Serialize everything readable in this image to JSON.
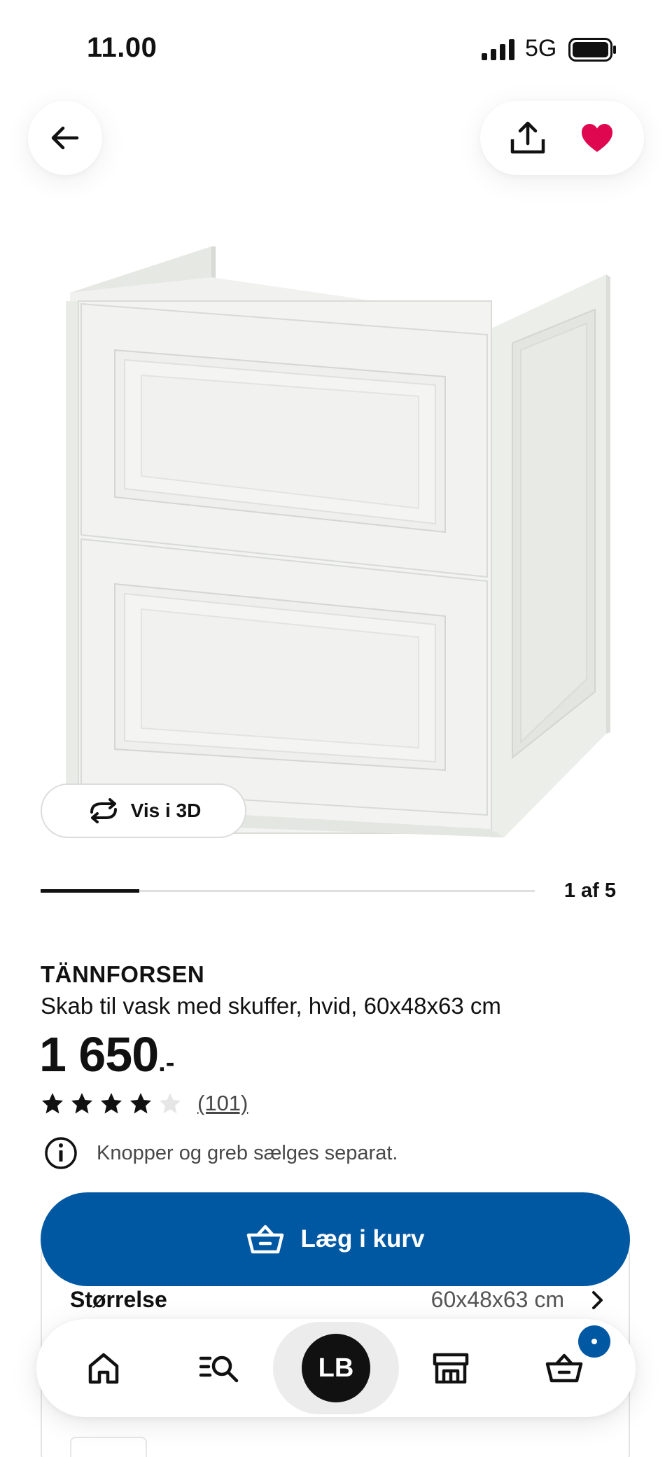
{
  "status_bar": {
    "time": "11.00",
    "network": "5G",
    "signal_icon": "cellular-signal-icon",
    "battery_icon": "battery-icon"
  },
  "header": {
    "back_icon": "arrow-left-icon",
    "share_icon": "share-upload-icon",
    "favorite_icon": "heart-filled-icon",
    "favorite_color": "#e00751"
  },
  "gallery": {
    "view_3d_label": "Vis i 3D",
    "view_3d_icon": "rotate-3d-icon",
    "position_label": "1 af 5",
    "progress_fraction": 0.2
  },
  "product": {
    "name": "TÄNNFORSEN",
    "description": "Skab til vask med skuffer, hvid, 60x48x63 cm",
    "price": "1 650",
    "price_suffix": ".-",
    "rating": 4,
    "rating_max": 5,
    "review_count": "(101)",
    "notice": "Knopper og greb sælges separat.",
    "notice_icon": "info-circle-icon"
  },
  "cart_button": {
    "label": "Læg i kurv",
    "icon": "basket-icon",
    "color": "#0058a3"
  },
  "options": {
    "size_label": "Størrelse",
    "size_value": "60x48x63 cm",
    "chevron_icon": "chevron-right-icon"
  },
  "bottom_nav": {
    "items": [
      {
        "name": "home",
        "icon": "home-icon"
      },
      {
        "name": "search",
        "icon": "search-list-icon"
      },
      {
        "name": "profile",
        "initials": "LB"
      },
      {
        "name": "stores",
        "icon": "store-icon"
      },
      {
        "name": "cart",
        "icon": "basket-icon"
      }
    ]
  }
}
